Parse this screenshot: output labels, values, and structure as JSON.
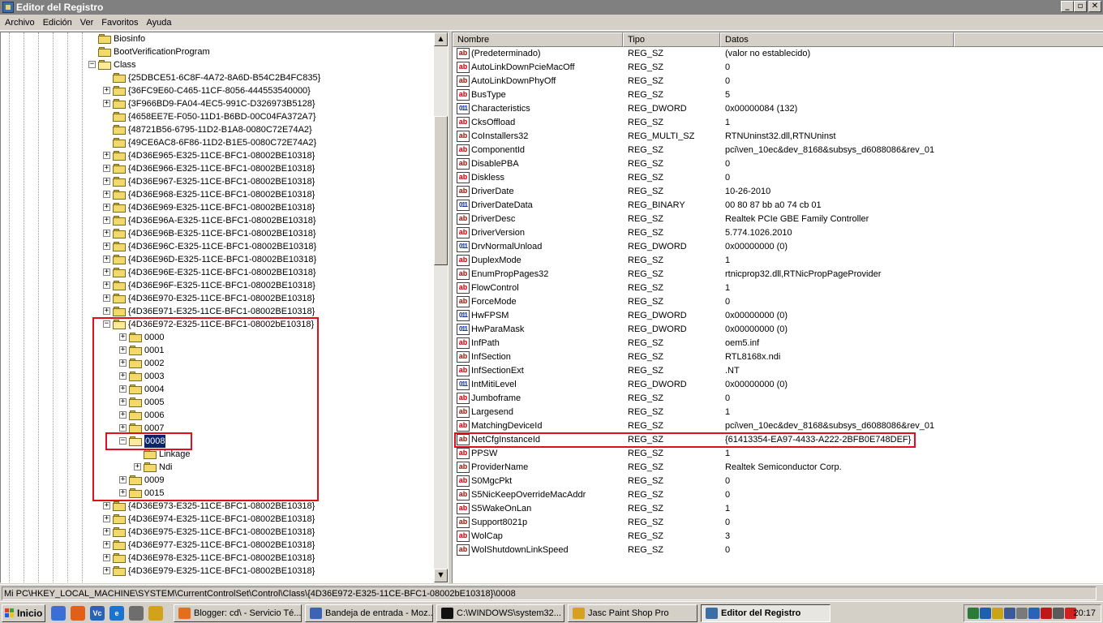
{
  "window": {
    "title": "Editor del Registro"
  },
  "menu": [
    "Archivo",
    "Edición",
    "Ver",
    "Favoritos",
    "Ayuda"
  ],
  "tree": [
    {
      "label": "Biosinfo",
      "level": 5,
      "exp": "none"
    },
    {
      "label": "BootVerificationProgram",
      "level": 5,
      "exp": "none"
    },
    {
      "label": "Class",
      "level": 5,
      "exp": "minus",
      "open": true
    },
    {
      "label": "{25DBCE51-6C8F-4A72-8A6D-B54C2B4FC835}",
      "level": 6,
      "exp": "none"
    },
    {
      "label": "{36FC9E60-C465-11CF-8056-444553540000}",
      "level": 6,
      "exp": "plus"
    },
    {
      "label": "{3F966BD9-FA04-4EC5-991C-D326973B5128}",
      "level": 6,
      "exp": "plus"
    },
    {
      "label": "{4658EE7E-F050-11D1-B6BD-00C04FA372A7}",
      "level": 6,
      "exp": "none"
    },
    {
      "label": "{48721B56-6795-11D2-B1A8-0080C72E74A2}",
      "level": 6,
      "exp": "none"
    },
    {
      "label": "{49CE6AC8-6F86-11D2-B1E5-0080C72E74A2}",
      "level": 6,
      "exp": "none"
    },
    {
      "label": "{4D36E965-E325-11CE-BFC1-08002BE10318}",
      "level": 6,
      "exp": "plus"
    },
    {
      "label": "{4D36E966-E325-11CE-BFC1-08002BE10318}",
      "level": 6,
      "exp": "plus"
    },
    {
      "label": "{4D36E967-E325-11CE-BFC1-08002BE10318}",
      "level": 6,
      "exp": "plus"
    },
    {
      "label": "{4D36E968-E325-11CE-BFC1-08002BE10318}",
      "level": 6,
      "exp": "plus"
    },
    {
      "label": "{4D36E969-E325-11CE-BFC1-08002BE10318}",
      "level": 6,
      "exp": "plus"
    },
    {
      "label": "{4D36E96A-E325-11CE-BFC1-08002BE10318}",
      "level": 6,
      "exp": "plus"
    },
    {
      "label": "{4D36E96B-E325-11CE-BFC1-08002BE10318}",
      "level": 6,
      "exp": "plus"
    },
    {
      "label": "{4D36E96C-E325-11CE-BFC1-08002BE10318}",
      "level": 6,
      "exp": "plus"
    },
    {
      "label": "{4D36E96D-E325-11CE-BFC1-08002BE10318}",
      "level": 6,
      "exp": "plus"
    },
    {
      "label": "{4D36E96E-E325-11CE-BFC1-08002BE10318}",
      "level": 6,
      "exp": "plus"
    },
    {
      "label": "{4D36E96F-E325-11CE-BFC1-08002BE10318}",
      "level": 6,
      "exp": "plus"
    },
    {
      "label": "{4D36E970-E325-11CE-BFC1-08002BE10318}",
      "level": 6,
      "exp": "plus"
    },
    {
      "label": "{4D36E971-E325-11CE-BFC1-08002BE10318}",
      "level": 6,
      "exp": "plus"
    },
    {
      "label": "{4D36E972-E325-11CE-BFC1-08002bE10318}",
      "level": 6,
      "exp": "minus",
      "open": true
    },
    {
      "label": "0000",
      "level": 7,
      "exp": "plus"
    },
    {
      "label": "0001",
      "level": 7,
      "exp": "plus"
    },
    {
      "label": "0002",
      "level": 7,
      "exp": "plus"
    },
    {
      "label": "0003",
      "level": 7,
      "exp": "plus"
    },
    {
      "label": "0004",
      "level": 7,
      "exp": "plus"
    },
    {
      "label": "0005",
      "level": 7,
      "exp": "plus"
    },
    {
      "label": "0006",
      "level": 7,
      "exp": "plus"
    },
    {
      "label": "0007",
      "level": 7,
      "exp": "plus"
    },
    {
      "label": "0008",
      "level": 7,
      "exp": "minus",
      "open": true,
      "selected": true
    },
    {
      "label": "Linkage",
      "level": 8,
      "exp": "none"
    },
    {
      "label": "Ndi",
      "level": 8,
      "exp": "plus"
    },
    {
      "label": "0009",
      "level": 7,
      "exp": "plus"
    },
    {
      "label": "0015",
      "level": 7,
      "exp": "plus"
    },
    {
      "label": "{4D36E973-E325-11CE-BFC1-08002BE10318}",
      "level": 6,
      "exp": "plus"
    },
    {
      "label": "{4D36E974-E325-11CE-BFC1-08002BE10318}",
      "level": 6,
      "exp": "plus"
    },
    {
      "label": "{4D36E975-E325-11CE-BFC1-08002BE10318}",
      "level": 6,
      "exp": "plus"
    },
    {
      "label": "{4D36E977-E325-11CE-BFC1-08002BE10318}",
      "level": 6,
      "exp": "plus"
    },
    {
      "label": "{4D36E978-E325-11CE-BFC1-08002BE10318}",
      "level": 6,
      "exp": "plus"
    },
    {
      "label": "{4D36E979-E325-11CE-BFC1-08002BE10318}",
      "level": 6,
      "exp": "plus"
    }
  ],
  "list": {
    "columns": [
      "Nombre",
      "Tipo",
      "Datos"
    ],
    "rows": [
      {
        "name": "(Predeterminado)",
        "type": "REG_SZ",
        "data": "(valor no establecido)",
        "icon": "sz"
      },
      {
        "name": "AutoLinkDownPcieMacOff",
        "type": "REG_SZ",
        "data": "0",
        "icon": "sz"
      },
      {
        "name": "AutoLinkDownPhyOff",
        "type": "REG_SZ",
        "data": "0",
        "icon": "sz"
      },
      {
        "name": "BusType",
        "type": "REG_SZ",
        "data": "5",
        "icon": "sz"
      },
      {
        "name": "Characteristics",
        "type": "REG_DWORD",
        "data": "0x00000084 (132)",
        "icon": "bin"
      },
      {
        "name": "CksOffload",
        "type": "REG_SZ",
        "data": "1",
        "icon": "sz"
      },
      {
        "name": "CoInstallers32",
        "type": "REG_MULTI_SZ",
        "data": "RTNUninst32.dll,RTNUninst",
        "icon": "sz"
      },
      {
        "name": "ComponentId",
        "type": "REG_SZ",
        "data": "pci\\ven_10ec&dev_8168&subsys_d6088086&rev_01",
        "icon": "sz"
      },
      {
        "name": "DisablePBA",
        "type": "REG_SZ",
        "data": "0",
        "icon": "sz"
      },
      {
        "name": "Diskless",
        "type": "REG_SZ",
        "data": "0",
        "icon": "sz"
      },
      {
        "name": "DriverDate",
        "type": "REG_SZ",
        "data": "10-26-2010",
        "icon": "sz"
      },
      {
        "name": "DriverDateData",
        "type": "REG_BINARY",
        "data": "00 80 87 bb a0 74 cb 01",
        "icon": "bin"
      },
      {
        "name": "DriverDesc",
        "type": "REG_SZ",
        "data": "Realtek PCIe GBE Family Controller",
        "icon": "sz"
      },
      {
        "name": "DriverVersion",
        "type": "REG_SZ",
        "data": "5.774.1026.2010",
        "icon": "sz"
      },
      {
        "name": "DrvNormalUnload",
        "type": "REG_DWORD",
        "data": "0x00000000 (0)",
        "icon": "bin"
      },
      {
        "name": "DuplexMode",
        "type": "REG_SZ",
        "data": "1",
        "icon": "sz"
      },
      {
        "name": "EnumPropPages32",
        "type": "REG_SZ",
        "data": "rtnicprop32.dll,RTNicPropPageProvider",
        "icon": "sz"
      },
      {
        "name": "FlowControl",
        "type": "REG_SZ",
        "data": "1",
        "icon": "sz"
      },
      {
        "name": "ForceMode",
        "type": "REG_SZ",
        "data": "0",
        "icon": "sz"
      },
      {
        "name": "HwFPSM",
        "type": "REG_DWORD",
        "data": "0x00000000 (0)",
        "icon": "bin"
      },
      {
        "name": "HwParaMask",
        "type": "REG_DWORD",
        "data": "0x00000000 (0)",
        "icon": "bin"
      },
      {
        "name": "InfPath",
        "type": "REG_SZ",
        "data": "oem5.inf",
        "icon": "sz"
      },
      {
        "name": "InfSection",
        "type": "REG_SZ",
        "data": "RTL8168x.ndi",
        "icon": "sz"
      },
      {
        "name": "InfSectionExt",
        "type": "REG_SZ",
        "data": ".NT",
        "icon": "sz"
      },
      {
        "name": "IntMitiLevel",
        "type": "REG_DWORD",
        "data": "0x00000000 (0)",
        "icon": "bin"
      },
      {
        "name": "Jumboframe",
        "type": "REG_SZ",
        "data": "0",
        "icon": "sz"
      },
      {
        "name": "Largesend",
        "type": "REG_SZ",
        "data": "1",
        "icon": "sz"
      },
      {
        "name": "MatchingDeviceId",
        "type": "REG_SZ",
        "data": "pci\\ven_10ec&dev_8168&subsys_d6088086&rev_01",
        "icon": "sz"
      },
      {
        "name": "NetCfgInstanceId",
        "type": "REG_SZ",
        "data": "{61413354-EA97-4433-A222-2BFB0E748DEF}",
        "icon": "sz"
      },
      {
        "name": "PPSW",
        "type": "REG_SZ",
        "data": "1",
        "icon": "sz"
      },
      {
        "name": "ProviderName",
        "type": "REG_SZ",
        "data": "Realtek Semiconductor Corp.",
        "icon": "sz"
      },
      {
        "name": "S0MgcPkt",
        "type": "REG_SZ",
        "data": "0",
        "icon": "sz"
      },
      {
        "name": "S5NicKeepOverrideMacAddr",
        "type": "REG_SZ",
        "data": "0",
        "icon": "sz"
      },
      {
        "name": "S5WakeOnLan",
        "type": "REG_SZ",
        "data": "1",
        "icon": "sz"
      },
      {
        "name": "Support8021p",
        "type": "REG_SZ",
        "data": "0",
        "icon": "sz"
      },
      {
        "name": "WolCap",
        "type": "REG_SZ",
        "data": "3",
        "icon": "sz"
      },
      {
        "name": "WolShutdownLinkSpeed",
        "type": "REG_SZ",
        "data": "0",
        "icon": "sz"
      }
    ]
  },
  "status": "Mi PC\\HKEY_LOCAL_MACHINE\\SYSTEM\\CurrentControlSet\\Control\\Class\\{4D36E972-E325-11CE-BFC1-08002bE10318}\\0008",
  "taskbar": {
    "start_label": "Inicio",
    "quicklaunch": [
      "desktop-icon",
      "firefox-icon",
      "vc-icon",
      "ie-icon",
      "media-icon",
      "folder-icon"
    ],
    "tasks": [
      {
        "label": "Blogger: cd\\ - Servicio Té...",
        "icon": "#e36f1e",
        "active": false
      },
      {
        "label": "Bandeja de entrada - Moz...",
        "icon": "#3c64b4",
        "active": false
      },
      {
        "label": "C:\\WINDOWS\\system32...",
        "icon": "#111111",
        "active": false
      },
      {
        "label": "Jasc Paint Shop Pro",
        "icon": "#d8a021",
        "active": false
      },
      {
        "label": "Editor del Registro",
        "icon": "#3a6ea5",
        "active": true
      }
    ],
    "tray_icons": [
      "network-icon",
      "antivirus-icon",
      "messenger-icon",
      "speaker-icon",
      "shield-icon",
      "vc-tray-icon",
      "update-icon",
      "sync-icon",
      "security-icon"
    ],
    "clock": "20:17"
  }
}
